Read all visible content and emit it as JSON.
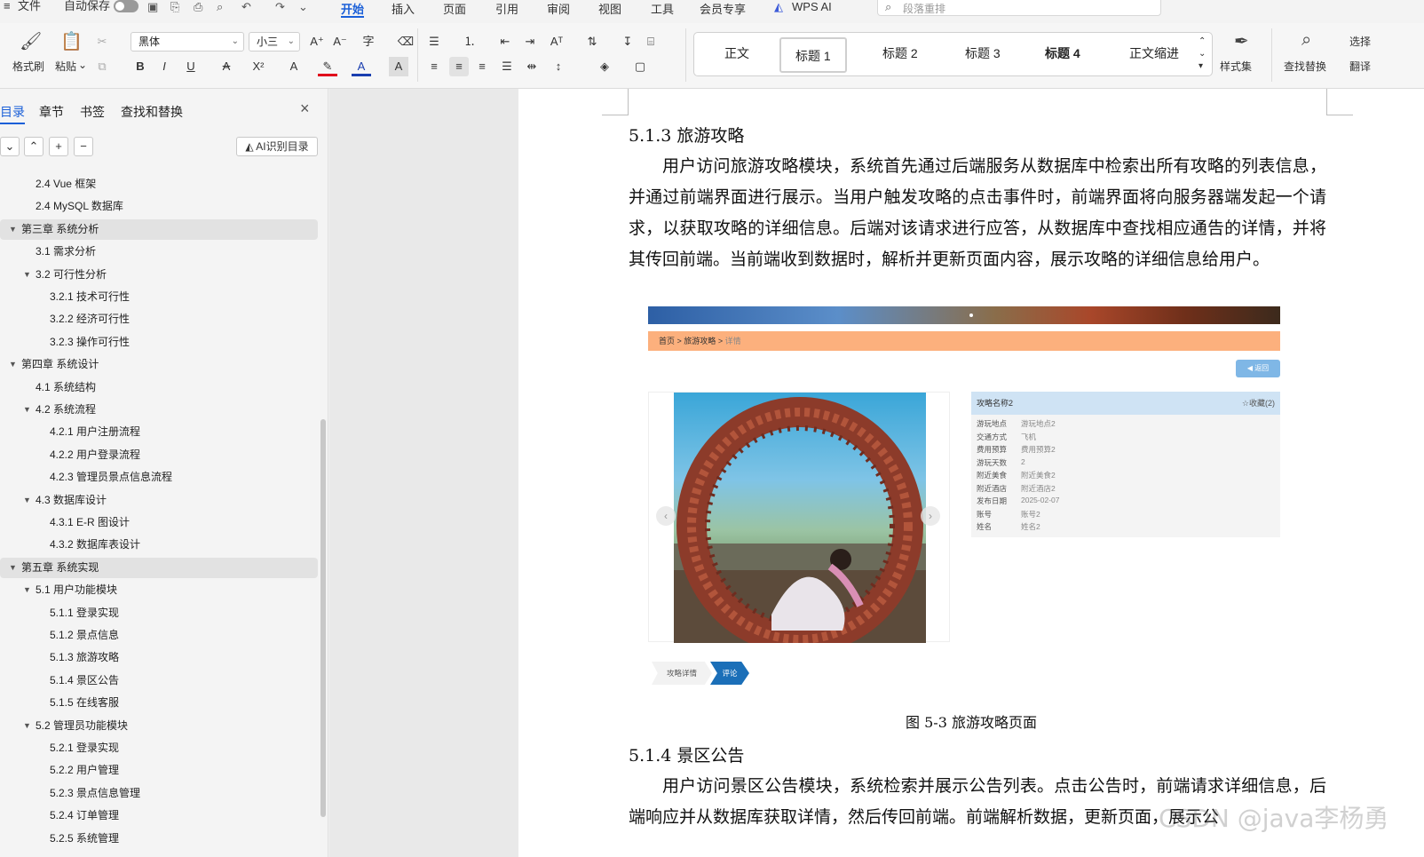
{
  "menubar": {
    "file": "文件",
    "autosave": "自动保存",
    "tabs": [
      "开始",
      "插入",
      "页面",
      "引用",
      "审阅",
      "视图",
      "工具",
      "会员专享",
      "WPS AI"
    ],
    "active_tab": "开始",
    "search_placeholder": "段落重排"
  },
  "ribbon": {
    "format_painter": "格式刷",
    "paste": "粘贴",
    "font_name": "黑体",
    "font_size": "小三",
    "styles": [
      "正文",
      "标题 1",
      "标题 2",
      "标题 3",
      "标题 4",
      "正文缩进"
    ],
    "selected_style": "标题 1",
    "style_set": "样式集",
    "find_replace": "查找替换",
    "select": "选择",
    "translate": "翻译",
    "font_color": "#c00000",
    "highlight_color": "#ffff00",
    "char_color": "#1a3fb0"
  },
  "nav": {
    "tabs": [
      "目录",
      "章节",
      "书签",
      "查找和替换"
    ],
    "active_tab": "目录",
    "ai_button": "AI识别目录",
    "toc": [
      {
        "label": "2.4 Vue 框架",
        "level": 2,
        "arrow": false,
        "hl": false
      },
      {
        "label": "2.4 MySQL 数据库",
        "level": 2,
        "arrow": false,
        "hl": false
      },
      {
        "label": "第三章  系统分析",
        "level": 1,
        "arrow": true,
        "hl": true
      },
      {
        "label": "3.1  需求分析",
        "level": 2,
        "arrow": false,
        "hl": false
      },
      {
        "label": "3.2  可行性分析",
        "level": 2,
        "arrow": true,
        "hl": false
      },
      {
        "label": "3.2.1  技术可行性",
        "level": 3,
        "arrow": false,
        "hl": false
      },
      {
        "label": "3.2.2  经济可行性",
        "level": 3,
        "arrow": false,
        "hl": false
      },
      {
        "label": "3.2.3  操作可行性",
        "level": 3,
        "arrow": false,
        "hl": false
      },
      {
        "label": "第四章  系统设计",
        "level": 1,
        "arrow": true,
        "hl": false
      },
      {
        "label": "4.1  系统结构",
        "level": 2,
        "arrow": false,
        "hl": false
      },
      {
        "label": "4.2  系统流程",
        "level": 2,
        "arrow": true,
        "hl": false
      },
      {
        "label": "4.2.1  用户注册流程",
        "level": 3,
        "arrow": false,
        "hl": false
      },
      {
        "label": "4.2.2  用户登录流程",
        "level": 3,
        "arrow": false,
        "hl": false
      },
      {
        "label": "4.2.3  管理员景点信息流程",
        "level": 3,
        "arrow": false,
        "hl": false
      },
      {
        "label": "4.3  数据库设计",
        "level": 2,
        "arrow": true,
        "hl": false
      },
      {
        "label": "4.3.1 E-R 图设计",
        "level": 3,
        "arrow": false,
        "hl": false
      },
      {
        "label": "4.3.2  数据库表设计",
        "level": 3,
        "arrow": false,
        "hl": false
      },
      {
        "label": "第五章  系统实现",
        "level": 1,
        "arrow": true,
        "hl": true
      },
      {
        "label": "5.1 用户功能模块",
        "level": 2,
        "arrow": true,
        "hl": false
      },
      {
        "label": "5.1.1  登录实现",
        "level": 3,
        "arrow": false,
        "hl": false
      },
      {
        "label": "5.1.2  景点信息",
        "level": 3,
        "arrow": false,
        "hl": false
      },
      {
        "label": "5.1.3  旅游攻略",
        "level": 3,
        "arrow": false,
        "hl": false
      },
      {
        "label": "5.1.4  景区公告",
        "level": 3,
        "arrow": false,
        "hl": false
      },
      {
        "label": "5.1.5  在线客服",
        "level": 3,
        "arrow": false,
        "hl": false
      },
      {
        "label": "5.2  管理员功能模块",
        "level": 2,
        "arrow": true,
        "hl": false
      },
      {
        "label": "5.2.1  登录实现",
        "level": 3,
        "arrow": false,
        "hl": false
      },
      {
        "label": "5.2.2  用户管理",
        "level": 3,
        "arrow": false,
        "hl": false
      },
      {
        "label": "5.2.3  景点信息管理",
        "level": 3,
        "arrow": false,
        "hl": false
      },
      {
        "label": "5.2.4  订单管理",
        "level": 3,
        "arrow": false,
        "hl": false
      },
      {
        "label": "5.2.5  系统管理",
        "level": 3,
        "arrow": false,
        "hl": false
      }
    ]
  },
  "doc": {
    "h_513": "5.1.3  旅游攻略",
    "p_513": "用户访问旅游攻略模块，系统首先通过后端服务从数据库中检索出所有攻略的列表信息，并通过前端界面进行展示。当用户触发攻略的点击事件时，前端界面将向服务器端发起一个请求，以获取攻略的详细信息。后端对该请求进行应答，从数据库中查找相应通告的详情，并将其传回前端。当前端收到数据时，解析并更新页面内容，展示攻略的详细信息给用户。",
    "figure": {
      "breadcrumb": [
        "首页",
        "旅游攻略",
        "详情"
      ],
      "back": "返回",
      "title": "攻略名称2",
      "fav": "☆收藏(2)",
      "rows": [
        {
          "k": "游玩地点",
          "v": "游玩地点2"
        },
        {
          "k": "交通方式",
          "v": "飞机"
        },
        {
          "k": "费用预算",
          "v": "费用预算2"
        },
        {
          "k": "游玩天数",
          "v": "2"
        },
        {
          "k": "附近美食",
          "v": "附近美食2"
        },
        {
          "k": "附近酒店",
          "v": "附近酒店2"
        },
        {
          "k": "发布日期",
          "v": "2025-02-07"
        },
        {
          "k": "账号",
          "v": "账号2"
        },
        {
          "k": "姓名",
          "v": "姓名2"
        }
      ],
      "tab_detail": "攻略详情",
      "tab_comment": "评论"
    },
    "caption": "图 5-3  旅游攻略页面",
    "h_514": "5.1.4  景区公告",
    "p_514": "用户访问景区公告模块，系统检索并展示公告列表。点击公告时，前端请求详细信息，后端响应并从数据库获取详情，然后传回前端。前端解析数据，更新页面，展示公"
  },
  "watermark": "CSDN @java李杨勇"
}
